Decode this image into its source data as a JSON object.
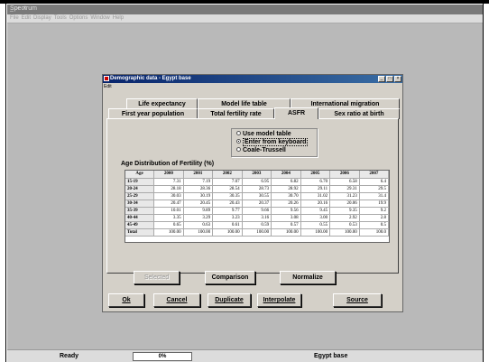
{
  "app": {
    "title": "Spectrum",
    "window_controls": "_ ▫ ×",
    "menu": [
      "File",
      "Edit",
      "Display",
      "Tools",
      "Options",
      "Window",
      "Help"
    ]
  },
  "dialog": {
    "title": "Demographic data - Egypt base",
    "menu": "Edit",
    "tabs_row1": [
      "Life expectancy",
      "Model life table",
      "International migration"
    ],
    "tabs_row2": [
      "First year population",
      "Total fertility rate",
      "ASFR",
      "Sex ratio at birth"
    ],
    "selected_tab": "ASFR",
    "radio": {
      "options": [
        "Use model table",
        "Enter from keyboard",
        "Coale-Trussell"
      ],
      "selected_index": 1
    },
    "table_title": "Age Distribution of Fertility (%)",
    "table": {
      "headers": [
        "Age",
        "2000",
        "2001",
        "2002",
        "2003",
        "2004",
        "2005",
        "2006",
        "2007"
      ],
      "rows": [
        [
          "15-19",
          "7.31",
          "7.19",
          "7.07",
          "6.95",
          "6.82",
          "6.70",
          "6.58",
          "6.4"
        ],
        [
          "20-24",
          "28.18",
          "28.36",
          "28.54",
          "28.73",
          "28.92",
          "29.11",
          "29.31",
          "29.5"
        ],
        [
          "25-29",
          "30.03",
          "30.19",
          "30.35",
          "30.55",
          "30.70",
          "31.02",
          "31.23",
          "31.4"
        ],
        [
          "30-34",
          "20.47",
          "20.45",
          "20.43",
          "20.37",
          "20.26",
          "20.16",
          "20.06",
          "19.9"
        ],
        [
          "35-39",
          "10.01",
          "9.89",
          "9.77",
          "9.66",
          "9.56",
          "9.45",
          "9.35",
          "9.2"
        ],
        [
          "40-44",
          "3.35",
          "3.29",
          "3.23",
          "3.16",
          "3.08",
          "3.00",
          "2.92",
          "2.8"
        ],
        [
          "45-49",
          "0.65",
          "0.63",
          "0.61",
          "0.59",
          "0.57",
          "0.55",
          "0.53",
          "0.5"
        ],
        [
          "Total",
          "100.00",
          "100.00",
          "100.00",
          "100.00",
          "100.00",
          "100.00",
          "100.00",
          "100.0"
        ]
      ]
    },
    "buttons_mid": {
      "selected": "Selected",
      "comparison": "Comparison",
      "normalize": "Normalize"
    },
    "buttons_bottom": {
      "ok": "Ok",
      "cancel": "Cancel",
      "duplicate": "Duplicate",
      "interpolate": "Interpolate",
      "source": "Source"
    },
    "window_controls": [
      "_",
      "□",
      "×"
    ]
  },
  "status": {
    "ready": "Ready",
    "progress": "0%",
    "progress_fraction": 0,
    "location": "Egypt base"
  }
}
